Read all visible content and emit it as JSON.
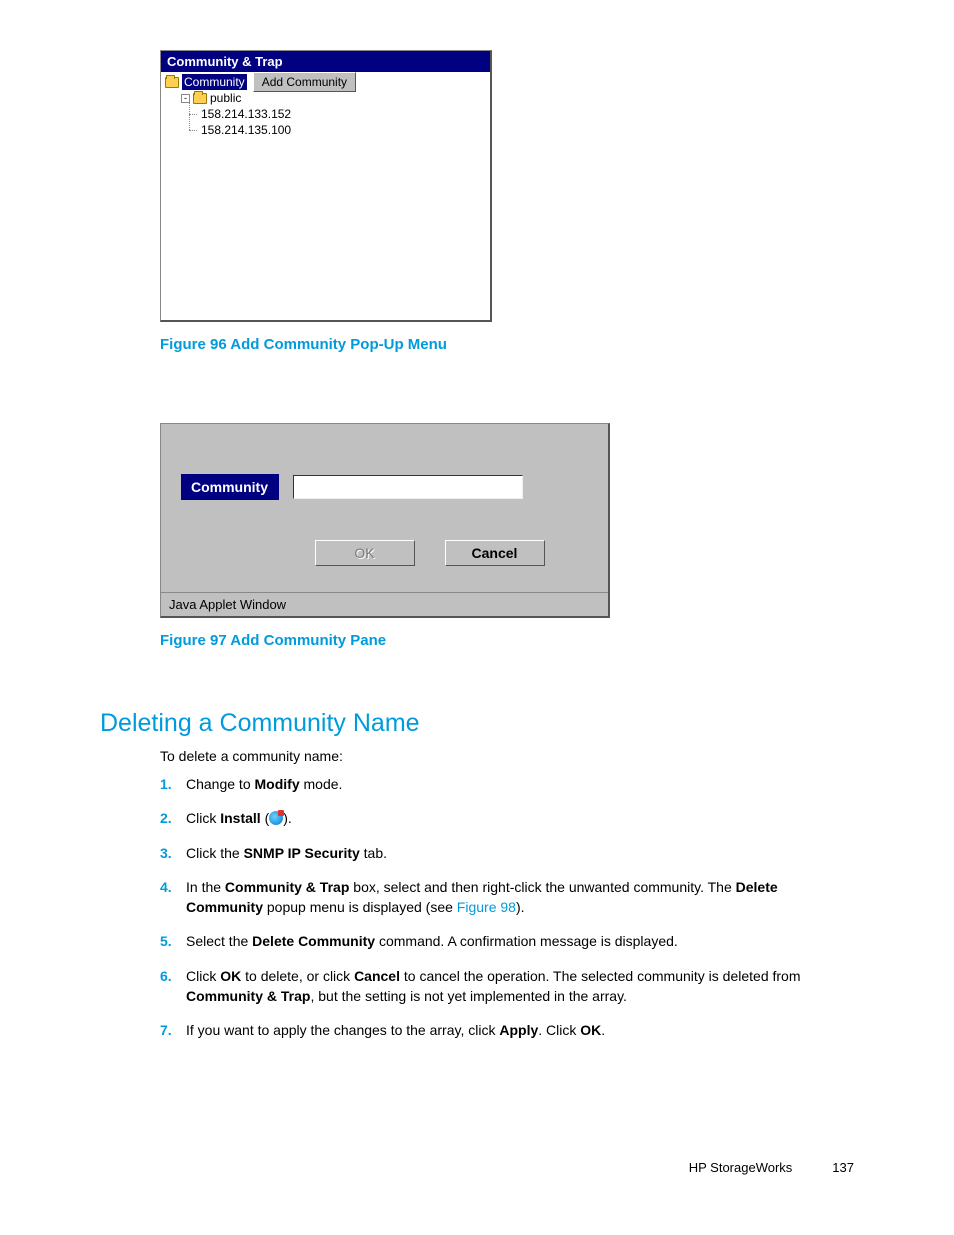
{
  "fig96": {
    "title": "Community & Trap",
    "tree": {
      "root": "Community",
      "popup": "Add Community",
      "child": "public",
      "ips": [
        "158.214.133.152",
        "158.214.135.100"
      ]
    },
    "caption": "Figure 96 Add Community Pop-Up Menu"
  },
  "fig97": {
    "label": "Community",
    "ok": "OK",
    "cancel": "Cancel",
    "status": "Java Applet Window",
    "caption": "Figure 97 Add Community Pane"
  },
  "section": {
    "heading": "Deleting a Community Name",
    "intro": "To delete a community name:"
  },
  "steps": {
    "s1a": "Change to ",
    "s1b": "Modify",
    "s1c": " mode.",
    "s2a": "Click ",
    "s2b": "Install",
    "s2c": " (",
    "s2d": ").",
    "s3a": "Click the ",
    "s3b": "SNMP IP Security",
    "s3c": " tab.",
    "s4a": "In the ",
    "s4b": "Community & Trap",
    "s4c": " box, select and then right-click the unwanted community. The ",
    "s4d": "Delete Community",
    "s4e": " popup menu is displayed (see ",
    "s4f": "Figure 98",
    "s4g": ").",
    "s5a": "Select the ",
    "s5b": "Delete Community",
    "s5c": " command. A confirmation message is displayed.",
    "s6a": "Click ",
    "s6b": "OK",
    "s6c": " to delete, or click ",
    "s6d": "Cancel",
    "s6e": " to cancel the operation. The selected community is deleted from ",
    "s6f": "Community & Trap",
    "s6g": ", but the setting is not yet implemented in the array.",
    "s7a": "If you want to apply the changes to the array, click ",
    "s7b": "Apply",
    "s7c": ". Click ",
    "s7d": "OK",
    "s7e": "."
  },
  "footer": {
    "brand": "HP StorageWorks",
    "page": "137"
  }
}
